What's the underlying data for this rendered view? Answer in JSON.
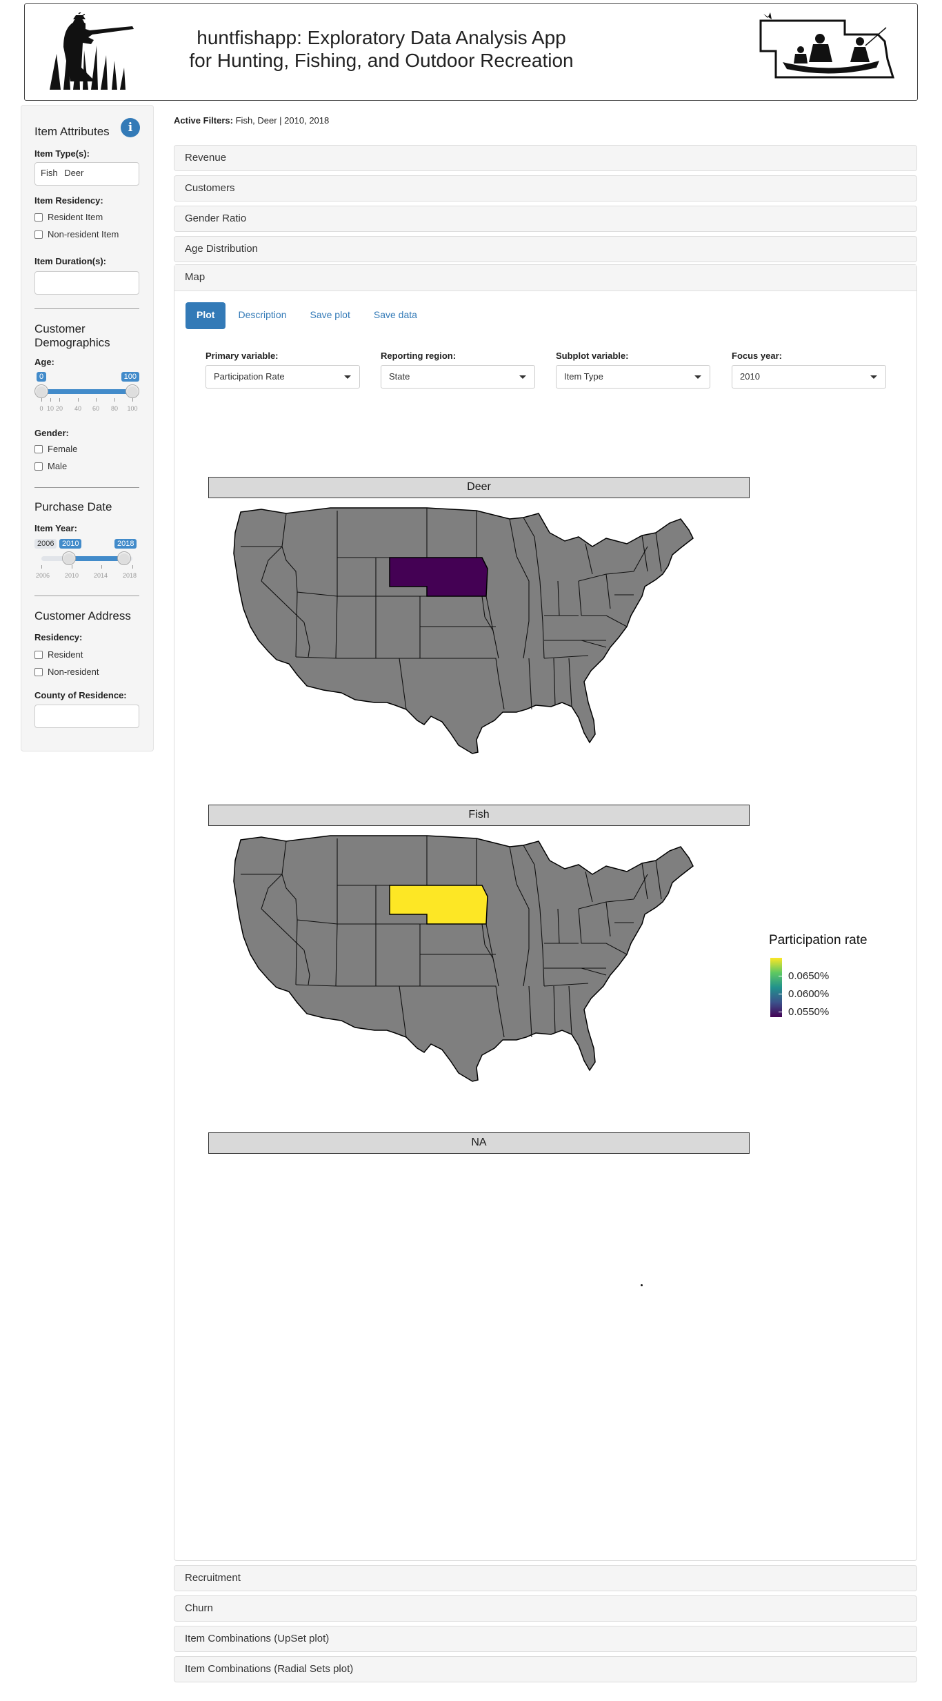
{
  "header": {
    "title_line1": "huntfishapp: Exploratory Data Analysis App",
    "title_line2": "for Hunting, Fishing, and Outdoor Recreation",
    "logo_left_icon": "hunter-silhouette-icon",
    "logo_right_icon": "nebraska-boat-fishing-icon"
  },
  "sidebar": {
    "item_attributes": {
      "heading": "Item Attributes",
      "info_icon": "info-icon",
      "item_types_label": "Item Type(s):",
      "item_types": [
        "Fish",
        "Deer"
      ],
      "residency_label": "Item Residency:",
      "residency_options": [
        "Resident Item",
        "Non-resident Item"
      ],
      "duration_label": "Item Duration(s):"
    },
    "demographics": {
      "heading": "Customer Demographics",
      "age_label": "Age:",
      "age_min": "0",
      "age_max": "100",
      "age_ticks": [
        "0",
        "10",
        "20",
        "40",
        "60",
        "80",
        "100"
      ],
      "gender_label": "Gender:",
      "gender_options": [
        "Female",
        "Male"
      ]
    },
    "purchase_date": {
      "heading": "Purchase Date",
      "year_label": "Item Year:",
      "year_min": "2006",
      "year_from": "2010",
      "year_to": "2018",
      "year_ticks": [
        "2006",
        "2010",
        "2014",
        "2018"
      ]
    },
    "address": {
      "heading": "Customer Address",
      "residency_label": "Residency:",
      "residency_options": [
        "Resident",
        "Non-resident"
      ],
      "county_label": "County of Residence:"
    }
  },
  "main": {
    "active_filters_label": "Active Filters:",
    "active_filters_value": "Fish, Deer | 2010, 2018",
    "panels_top": [
      "Revenue",
      "Customers",
      "Gender Ratio",
      "Age Distribution"
    ],
    "map_panel_title": "Map",
    "tabs": [
      "Plot",
      "Description",
      "Save plot",
      "Save data"
    ],
    "controls": [
      {
        "label": "Primary variable:",
        "value": "Participation Rate"
      },
      {
        "label": "Reporting region:",
        "value": "State"
      },
      {
        "label": "Subplot variable:",
        "value": "Item Type"
      },
      {
        "label": "Focus year:",
        "value": "2010"
      }
    ],
    "panels_bottom": [
      "Recruitment",
      "Churn",
      "Item Combinations (UpSet plot)",
      "Item Combinations (Radial Sets plot)"
    ]
  },
  "chart_data": {
    "type": "map",
    "region": "State",
    "facets": [
      "Deer",
      "Fish",
      "NA"
    ],
    "highlighted_state": "Nebraska",
    "values": [
      {
        "facet": "Deer",
        "state": "Nebraska",
        "participation_rate_pct": 0.0545
      },
      {
        "facet": "Fish",
        "state": "Nebraska",
        "participation_rate_pct": 0.068
      }
    ],
    "default_state_color": "#7f7f7f",
    "legend": {
      "title": "Participation rate",
      "labels": [
        "0.0650%",
        "0.0600%",
        "0.0550%"
      ],
      "low_color": "#440154",
      "high_color": "#fde725"
    }
  }
}
